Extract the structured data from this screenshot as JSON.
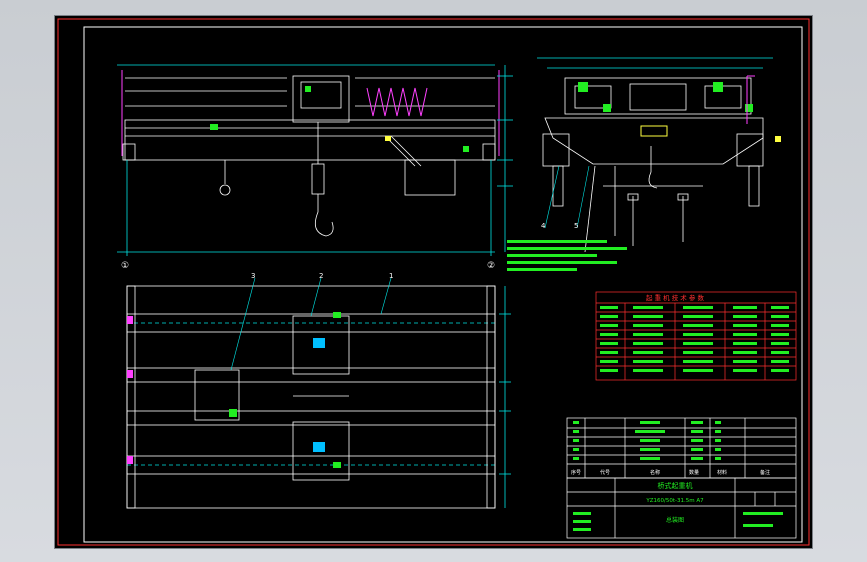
{
  "drawing": {
    "parts_list_header": "起 重 机 技 术 参 数",
    "parts_columns": [
      "序号",
      "代号",
      "名称",
      "数量",
      "材料",
      "备注"
    ],
    "title_lines": [
      "桥式起重机",
      "YZ160/50t-31.5m A7"
    ],
    "general_assembly": "总装图",
    "item_labels": [
      "1",
      "2",
      "3",
      "4",
      "5"
    ],
    "axis_marks": [
      "①",
      "②"
    ],
    "colors": {
      "sheet_bg": "#000000",
      "lines": "#ffffff",
      "dims": "#00e5e5",
      "frame": "#ff3030",
      "accent_green": "#22ee22",
      "accent_magenta": "#ff40ff",
      "accent_yellow": "#ffff40"
    }
  }
}
